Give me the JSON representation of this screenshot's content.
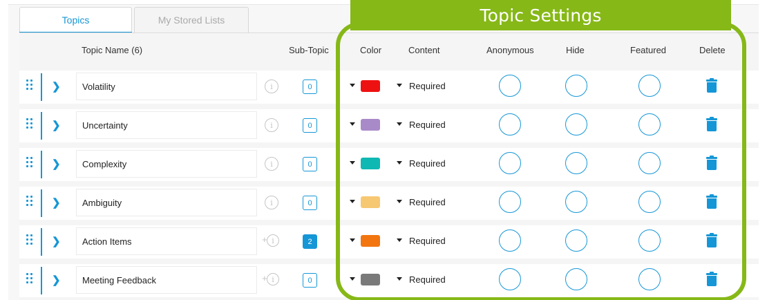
{
  "tabs": [
    {
      "label": "Topics",
      "active": true
    },
    {
      "label": "My Stored Lists",
      "active": false
    }
  ],
  "overlay": {
    "title": "Topic Settings",
    "color": "#86b817"
  },
  "columns": {
    "topic_name": "Topic Name (6)",
    "sub_topic": "Sub-Topic",
    "color": "Color",
    "content": "Content",
    "anonymous": "Anonymous",
    "hide": "Hide",
    "featured": "Featured",
    "delete": "Delete"
  },
  "rows": [
    {
      "name": "Volatility",
      "info_icon": "info-icon",
      "sub_topic_count": "0",
      "count_filled": false,
      "color": "#ee1111",
      "content": "Required"
    },
    {
      "name": "Uncertainty",
      "info_icon": "info-icon",
      "sub_topic_count": "0",
      "count_filled": false,
      "color": "#a98ac8",
      "content": "Required"
    },
    {
      "name": "Complexity",
      "info_icon": "info-icon",
      "sub_topic_count": "0",
      "count_filled": false,
      "color": "#0fb8b3",
      "content": "Required"
    },
    {
      "name": "Ambiguity",
      "info_icon": "info-icon",
      "sub_topic_count": "0",
      "count_filled": false,
      "color": "#f7c872",
      "content": "Required"
    },
    {
      "name": "Action Items",
      "info_icon": "add-info-icon",
      "sub_topic_count": "2",
      "count_filled": true,
      "color": "#f2750f",
      "content": "Required"
    },
    {
      "name": "Meeting Feedback",
      "info_icon": "add-info-icon",
      "sub_topic_count": "0",
      "count_filled": false,
      "color": "#7a7a7a",
      "content": "Required"
    }
  ],
  "accent_color": "#1596d6"
}
